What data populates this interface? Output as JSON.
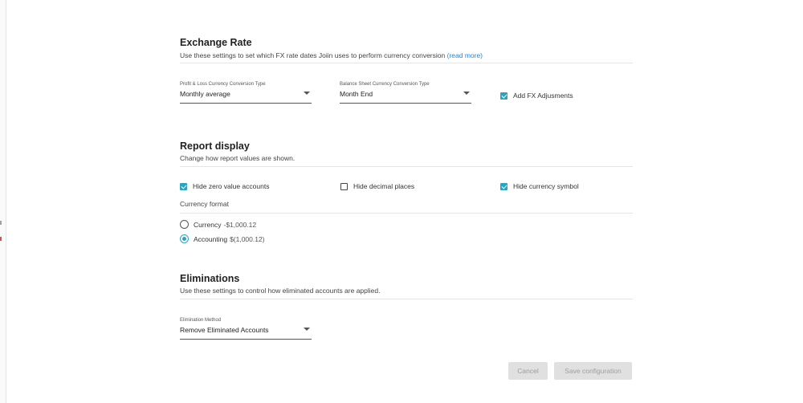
{
  "exchange_rate": {
    "title": "Exchange Rate",
    "subtitle": "Use these settings to set which FX rate dates Joiin uses to perform currency conversion",
    "read_more": "(read more)",
    "pl_select": {
      "label": "Profit & Loss Currency Conversion Type",
      "value": "Monthly average"
    },
    "bs_select": {
      "label": "Balance Sheet Currency Conversion Type",
      "value": "Month End"
    },
    "fx_adjustments": {
      "label": "Add FX Adjusments",
      "checked": true
    }
  },
  "report_display": {
    "title": "Report display",
    "subtitle": "Change how report values are shown.",
    "hide_zero": {
      "label": "Hide zero value accounts",
      "checked": true
    },
    "hide_decimal": {
      "label": "Hide decimal places",
      "checked": false
    },
    "hide_currency_symbol": {
      "label": "Hide currency symbol",
      "checked": true
    },
    "currency_format_label": "Currency format",
    "options": [
      {
        "label": "Currency",
        "example": "-$1,000.12",
        "selected": false
      },
      {
        "label": "Accounting",
        "example": "$(1,000.12)",
        "selected": true
      }
    ]
  },
  "eliminations": {
    "title": "Eliminations",
    "subtitle": "Use these settings to control how eliminated accounts are applied.",
    "method_select": {
      "label": "Elimination Method",
      "value": "Remove Eliminated Accounts"
    }
  },
  "actions": {
    "cancel": "Cancel",
    "save": "Save configuration"
  },
  "colors": {
    "accent": "#26a6c4",
    "link": "#1e88e5",
    "button_disabled_bg": "#e0e0e0",
    "button_disabled_text": "#9e9e9e"
  }
}
